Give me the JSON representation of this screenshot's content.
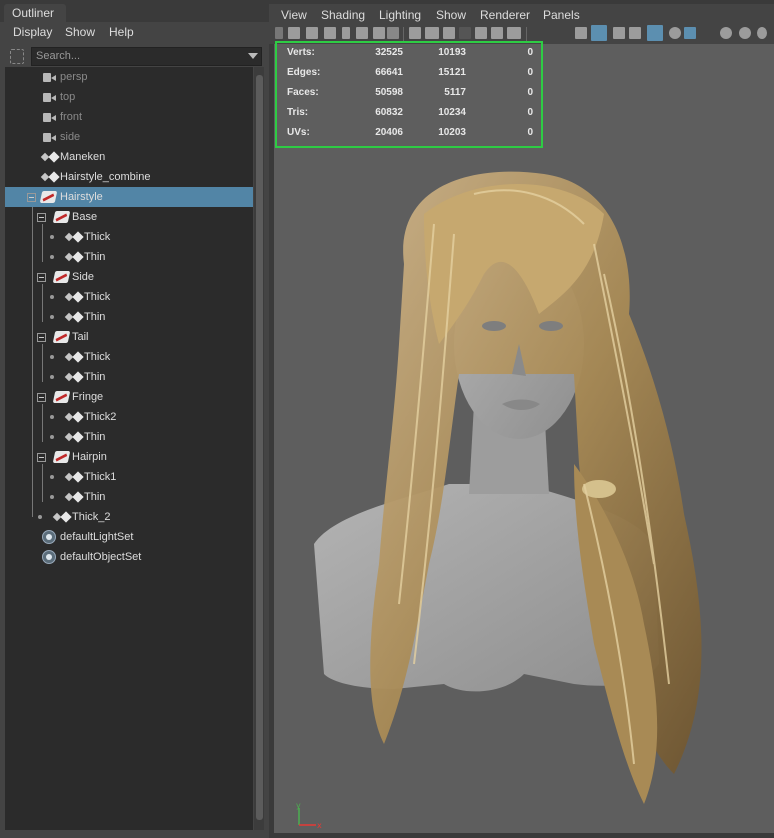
{
  "outliner": {
    "tab_label": "Outliner",
    "menu": [
      "Display",
      "Show",
      "Help"
    ],
    "search_placeholder": "Search...",
    "items": [
      {
        "label": "persp",
        "icon": "camera-icon",
        "dim": true
      },
      {
        "label": "top",
        "icon": "camera-icon",
        "dim": true
      },
      {
        "label": "front",
        "icon": "camera-icon",
        "dim": true
      },
      {
        "label": "side",
        "icon": "camera-icon",
        "dim": true
      },
      {
        "label": "Maneken",
        "icon": "transform-icon"
      },
      {
        "label": "Hairstyle_combine",
        "icon": "transform-icon"
      },
      {
        "label": "Hairstyle",
        "icon": "hair-group-icon",
        "selected": true
      },
      {
        "label": "Base",
        "icon": "hair-group-icon"
      },
      {
        "label": "Thick",
        "icon": "transform-icon"
      },
      {
        "label": "Thin",
        "icon": "transform-icon"
      },
      {
        "label": "Side",
        "icon": "hair-group-icon"
      },
      {
        "label": "Thick",
        "icon": "transform-icon"
      },
      {
        "label": "Thin",
        "icon": "transform-icon"
      },
      {
        "label": "Tail",
        "icon": "hair-group-icon"
      },
      {
        "label": "Thick",
        "icon": "transform-icon"
      },
      {
        "label": "Thin",
        "icon": "transform-icon"
      },
      {
        "label": "Fringe",
        "icon": "hair-group-icon"
      },
      {
        "label": "Thick2",
        "icon": "transform-icon"
      },
      {
        "label": "Thin",
        "icon": "transform-icon"
      },
      {
        "label": "Hairpin",
        "icon": "hair-group-icon"
      },
      {
        "label": "Thick1",
        "icon": "transform-icon"
      },
      {
        "label": "Thin",
        "icon": "transform-icon"
      },
      {
        "label": "Thick_2",
        "icon": "transform-icon"
      },
      {
        "label": "defaultLightSet",
        "icon": "set-icon"
      },
      {
        "label": "defaultObjectSet",
        "icon": "set-icon"
      }
    ]
  },
  "viewport": {
    "menu": [
      "View",
      "Shading",
      "Lighting",
      "Show",
      "Renderer",
      "Panels"
    ],
    "hud": {
      "rows": [
        {
          "key": "Verts:",
          "v1": "32525",
          "v2": "10193",
          "v3": "0"
        },
        {
          "key": "Edges:",
          "v1": "66641",
          "v2": "15121",
          "v3": "0"
        },
        {
          "key": "Faces:",
          "v1": "50598",
          "v2": "5117",
          "v3": "0"
        },
        {
          "key": "Tris:",
          "v1": "60832",
          "v2": "10234",
          "v3": "0"
        },
        {
          "key": "UVs:",
          "v1": "20406",
          "v2": "10203",
          "v3": "0"
        }
      ],
      "highlight_color": "#2ecc44"
    },
    "axis_labels": {
      "y": "y",
      "x": "x"
    }
  },
  "colors": {
    "selection": "#5285a6",
    "hair": "#b89a66",
    "bust": "#a8a8a8",
    "viewport_bg": "#5e5e5e"
  }
}
